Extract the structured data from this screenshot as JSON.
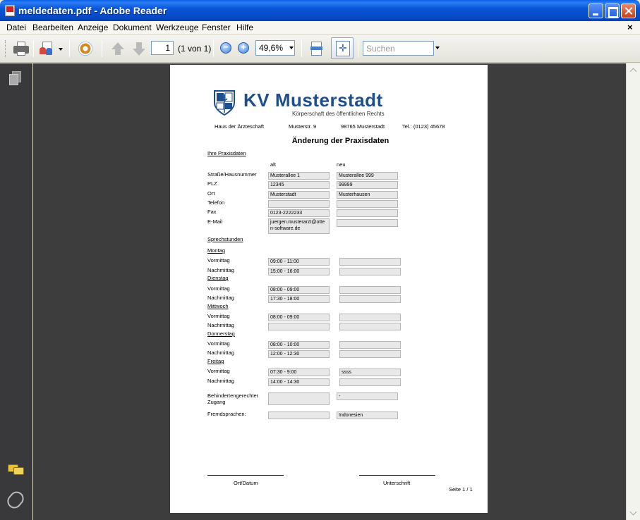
{
  "window": {
    "title": "meldedaten.pdf - Adobe Reader"
  },
  "menu": [
    "Datei",
    "Bearbeiten",
    "Anzeige",
    "Dokument",
    "Werkzeuge",
    "Fenster",
    "Hilfe"
  ],
  "toolbar": {
    "page_current": "1",
    "page_of": "(1 von 1)",
    "zoom": "49,6%",
    "search_placeholder": "Suchen"
  },
  "doc": {
    "org_title": "KV Musterstadt",
    "org_subtitle": "Körperschaft des öffentlichen Rechts",
    "address": [
      "Haus der Ärzteschaft",
      "Musterstr. 9",
      "98765 Musterstadt",
      "Tel.: (0123) 45678"
    ],
    "form_title": "Änderung der Praxisdaten",
    "section_practice": "Ihre Praxisdaten",
    "col_old": "alt",
    "col_new": "neu",
    "practice_rows": [
      {
        "label": "Straße/Hausnummer",
        "old": "Musterallee 1",
        "new": "Musterallee 999"
      },
      {
        "label": "PLZ",
        "old": "12345",
        "new": "99999"
      },
      {
        "label": "Ort",
        "old": "Musterstadt",
        "new": "Musterhausen"
      },
      {
        "label": "Telefon",
        "old": "",
        "new": ""
      },
      {
        "label": "Fax",
        "old": "0123-2222233",
        "new": ""
      },
      {
        "label": "E-Mail",
        "old": "juergen.musterarzt@otten-software.de",
        "new": ""
      }
    ],
    "section_hours": "Sprechstunden",
    "days": [
      {
        "name": "Montag",
        "am": "09:00 - 11:00",
        "am_new": "",
        "pm": "15:00 - 16:00",
        "pm_new": ""
      },
      {
        "name": "Dienstag",
        "am": "08:00 - 09:00",
        "am_new": "",
        "pm": "17:30 - 18:00",
        "pm_new": ""
      },
      {
        "name": "Mittwoch",
        "am": "08:00 - 09:00",
        "am_new": "",
        "pm": "",
        "pm_new": ""
      },
      {
        "name": "Donnerstag",
        "am": "08:00 - 10:00",
        "am_new": "",
        "pm": "12:00 - 12:30",
        "pm_new": ""
      },
      {
        "name": "Freitag",
        "am": "07:30 - 9:00",
        "am_new": "ssss",
        "pm": "14:00 - 14:30",
        "pm_new": ""
      }
    ],
    "label_am": "Vormittag",
    "label_pm": "Nachmittag",
    "accessible_label_1": "Behindertengerechter",
    "accessible_label_2": "Zugang",
    "accessible_old": "",
    "accessible_new": "-",
    "languages_label": "Fremdsprachen:",
    "languages_old": "",
    "languages_new": "Indonesien",
    "sig_left": "Ort/Datum",
    "sig_right": "Unterschrift",
    "page_footer": "Seite 1 / 1"
  }
}
